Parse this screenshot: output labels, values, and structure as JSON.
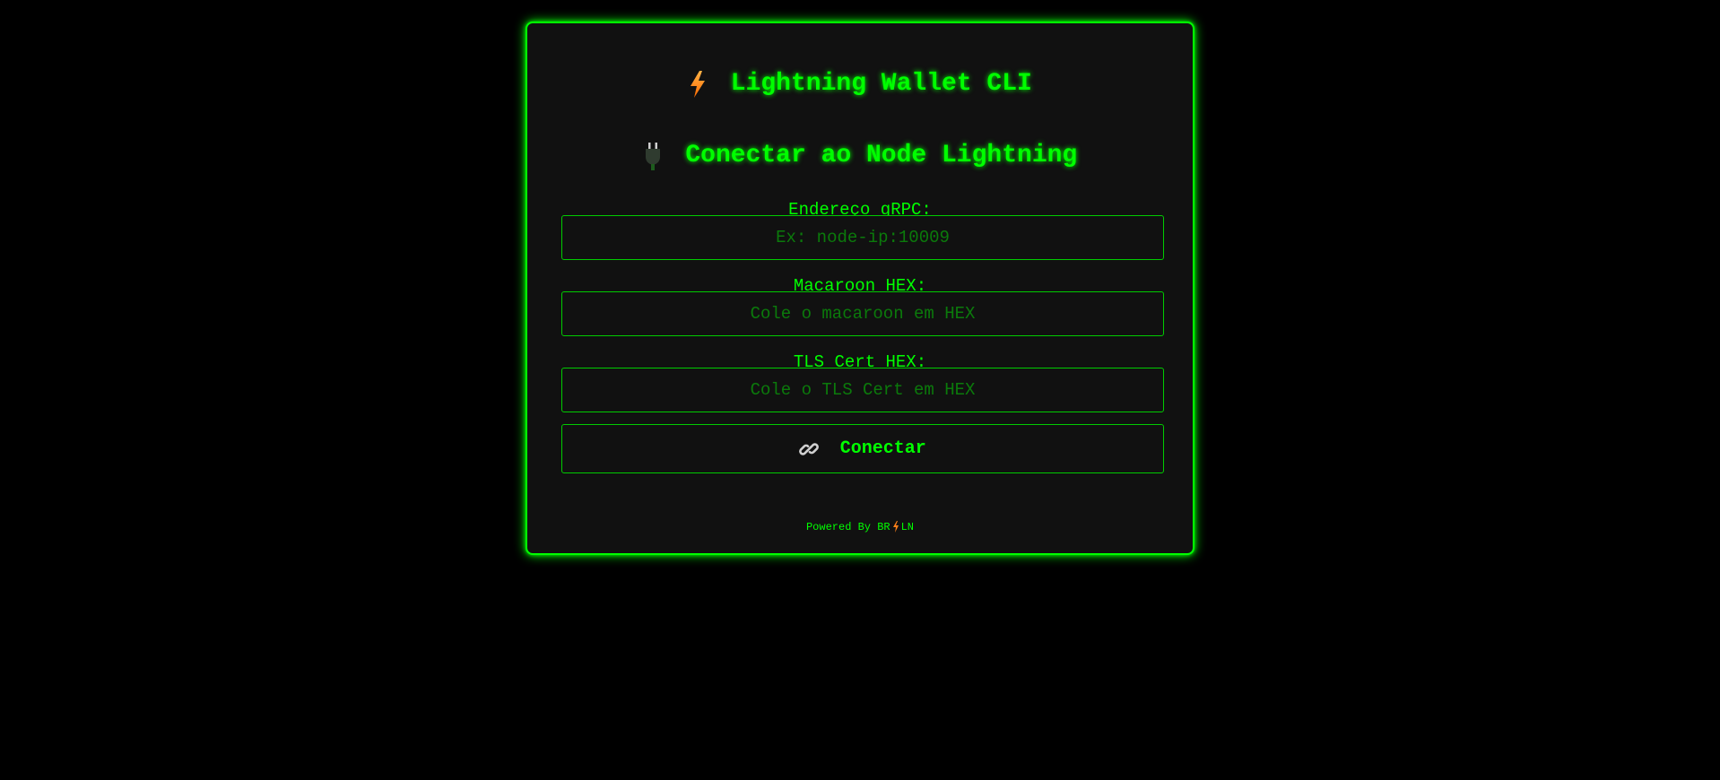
{
  "header": {
    "title": "Lightning Wallet CLI",
    "title_icon": "lightning-bolt-icon"
  },
  "connect_form": {
    "heading": "Conectar ao Node Lightning",
    "heading_icon": "plug-icon",
    "grpc": {
      "label": "Endereço gRPC:",
      "placeholder": "Ex: node-ip:10009",
      "value": ""
    },
    "macaroon": {
      "label": "Macaroon HEX:",
      "placeholder": "Cole o macaroon em HEX",
      "value": ""
    },
    "tls": {
      "label": "TLS Cert HEX:",
      "placeholder": "Cole o TLS Cert em HEX",
      "value": ""
    },
    "connect_button": {
      "label": "Conectar",
      "icon": "link-icon"
    }
  },
  "footer": {
    "powered_by": "Powered By BR",
    "suffix": "LN"
  },
  "colors": {
    "background": "#000000",
    "panel": "#111111",
    "accent": "#00ff00",
    "placeholder": "#0b7a0b",
    "bolt": "#ff8c1a"
  }
}
